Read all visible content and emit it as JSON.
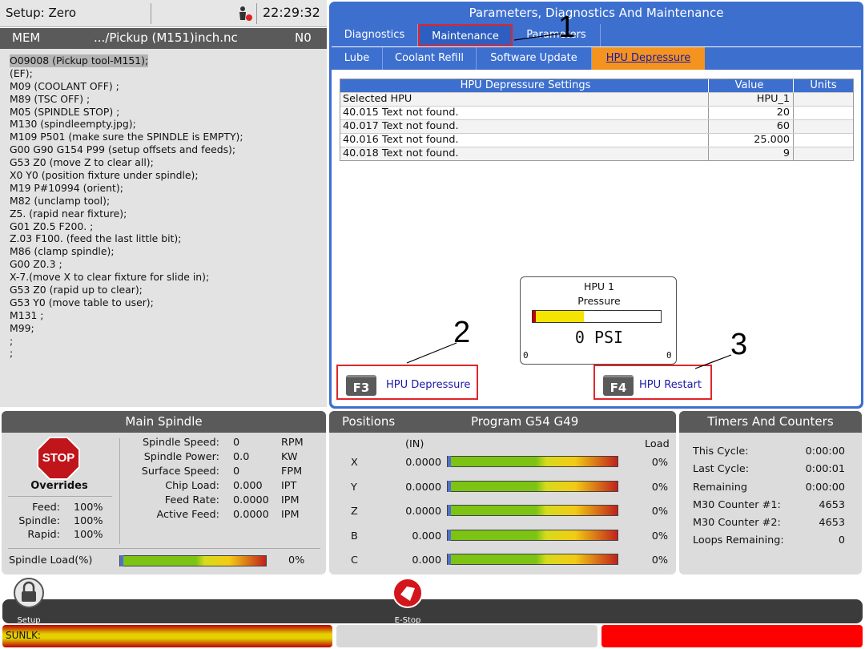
{
  "topbar": {
    "setup_mode": "Setup: Zero",
    "time": "22:29:32"
  },
  "mem_bar": {
    "mode": "MEM",
    "file": ".../Pickup (M151)inch.nc",
    "line": "N0"
  },
  "program_lines": [
    "O09008 (Pickup tool-M151);",
    "(EF);",
    "M09 (COOLANT OFF) ;",
    "M89 (TSC OFF) ;",
    "M05 (SPINDLE STOP) ;",
    "M130 (spindleempty.jpg);",
    "M109 P501 (make sure the SPINDLE is EMPTY);",
    "G00 G90 G154 P99 (setup offsets and feeds);",
    "G53 Z0 (move Z to clear all);",
    "X0 Y0 (position fixture under spindle);",
    "M19 P#10994 (orient);",
    "M82 (unclamp tool);",
    "Z5. (rapid near fixture);",
    "G01 Z0.5 F200. ;",
    "Z.03 F100. (feed the last little bit);",
    "M86 (clamp spindle);",
    "G00 Z0.3 ;",
    "X-7.(move X to clear fixture for slide in);",
    "G53 Z0 (rapid up to clear);",
    "G53 Y0 (move table to user);",
    "M131 ;",
    "M99;",
    ";",
    ";"
  ],
  "pdm": {
    "title": "Parameters, Diagnostics And Maintenance",
    "tabs": [
      "Diagnostics",
      "Maintenance",
      "Parameters"
    ],
    "subtabs": [
      "Lube",
      "Coolant Refill",
      "Software Update",
      "HPU Depressure"
    ],
    "table": {
      "headers": [
        "HPU Depressure Settings",
        "Value",
        "Units"
      ],
      "rows": [
        [
          "Selected HPU",
          "HPU_1",
          ""
        ],
        [
          "40.015 Text not found.",
          "20",
          ""
        ],
        [
          "40.017 Text not found.",
          "60",
          ""
        ],
        [
          "40.016 Text not found.",
          "25.000",
          ""
        ],
        [
          "40.018 Text not found.",
          "9",
          ""
        ]
      ]
    },
    "gauge": {
      "title": "HPU 1",
      "subtitle": "Pressure",
      "value": "0 PSI",
      "min": "0",
      "max": "0",
      "fill_fraction": 0.4
    },
    "f3": {
      "key": "F3",
      "label": "HPU Depressure"
    },
    "f4": {
      "key": "F4",
      "label": "HPU Restart"
    },
    "callouts": [
      "1",
      "2",
      "3"
    ]
  },
  "main_spindle": {
    "title": "Main Spindle",
    "stop": "STOP",
    "overrides_label": "Overrides",
    "overrides": [
      {
        "label": "Feed:",
        "value": "100%"
      },
      {
        "label": "Spindle:",
        "value": "100%"
      },
      {
        "label": "Rapid:",
        "value": "100%"
      }
    ],
    "stats": [
      {
        "label": "Spindle Speed:",
        "value": "0",
        "unit": "RPM"
      },
      {
        "label": "Spindle Power:",
        "value": "0.0",
        "unit": "KW"
      },
      {
        "label": "Surface Speed:",
        "value": "0",
        "unit": "FPM"
      },
      {
        "label": "Chip Load:",
        "value": "0.000",
        "unit": "IPT"
      },
      {
        "label": "Feed Rate:",
        "value": "0.0000",
        "unit": "IPM"
      },
      {
        "label": "Active Feed:",
        "value": "0.0000",
        "unit": "IPM"
      }
    ],
    "load_label": "Spindle Load(%)",
    "load_value": "0%"
  },
  "positions": {
    "title": "Positions",
    "program": "Program G54 G49",
    "unit": "(IN)",
    "load_label": "Load",
    "axes": [
      {
        "axis": "X",
        "value": "0.0000",
        "load": "0%"
      },
      {
        "axis": "Y",
        "value": "0.0000",
        "load": "0%"
      },
      {
        "axis": "Z",
        "value": "0.0000",
        "load": "0%"
      },
      {
        "axis": "B",
        "value": "0.000",
        "load": "0%"
      },
      {
        "axis": "C",
        "value": "0.000",
        "load": "0%"
      }
    ]
  },
  "timers": {
    "title": "Timers And Counters",
    "rows": [
      {
        "label": "This Cycle:",
        "value": "0:00:00"
      },
      {
        "label": "Last Cycle:",
        "value": "0:00:01"
      },
      {
        "label": "Remaining",
        "value": "0:00:00"
      },
      {
        "label": "M30 Counter #1:",
        "value": "4653"
      },
      {
        "label": "M30 Counter #2:",
        "value": "4653"
      },
      {
        "label": "Loops Remaining:",
        "value": "0"
      }
    ]
  },
  "bottom": {
    "setup": "Setup",
    "estop": "E-Stop",
    "status": "SUNLK:"
  },
  "colors": {
    "accent_blue": "#3d6fcf",
    "active_tab": "#f4931f",
    "highlight": "#e0262a"
  }
}
